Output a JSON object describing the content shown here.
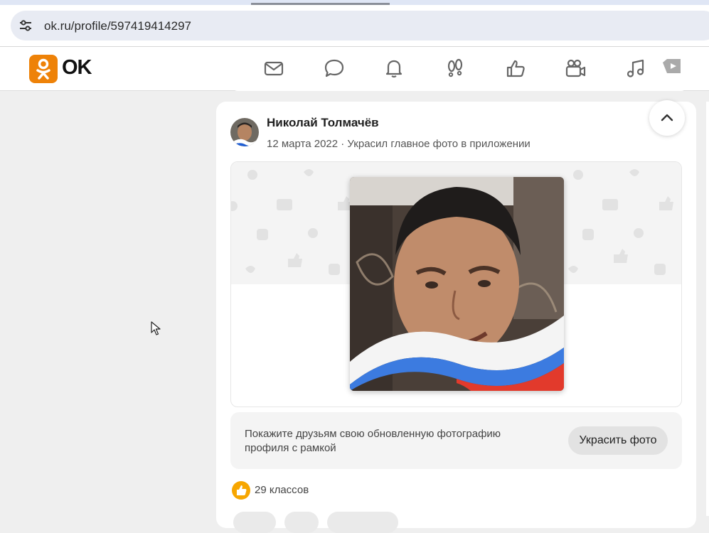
{
  "browser": {
    "url": "ok.ru/profile/597419414297",
    "site_icon": "tune-icon"
  },
  "header": {
    "logo_text": "OK",
    "nav_icons": [
      "mail-icon",
      "discussions-icon",
      "notifications-icon",
      "guests-icon",
      "likes-icon",
      "video-icon",
      "music-icon",
      "video-play-icon"
    ]
  },
  "post": {
    "author": "Николай Толмачёв",
    "meta": "12 марта 2022 · Украсил главное фото в приложении",
    "promo_text": "Покажите друзьям свою обновленную фотографию профиля с рамкой",
    "promo_button": "Украсить фото",
    "likes_text": "29 классов"
  },
  "colors": {
    "brand": "#ee8208",
    "like": "#f7a600"
  }
}
